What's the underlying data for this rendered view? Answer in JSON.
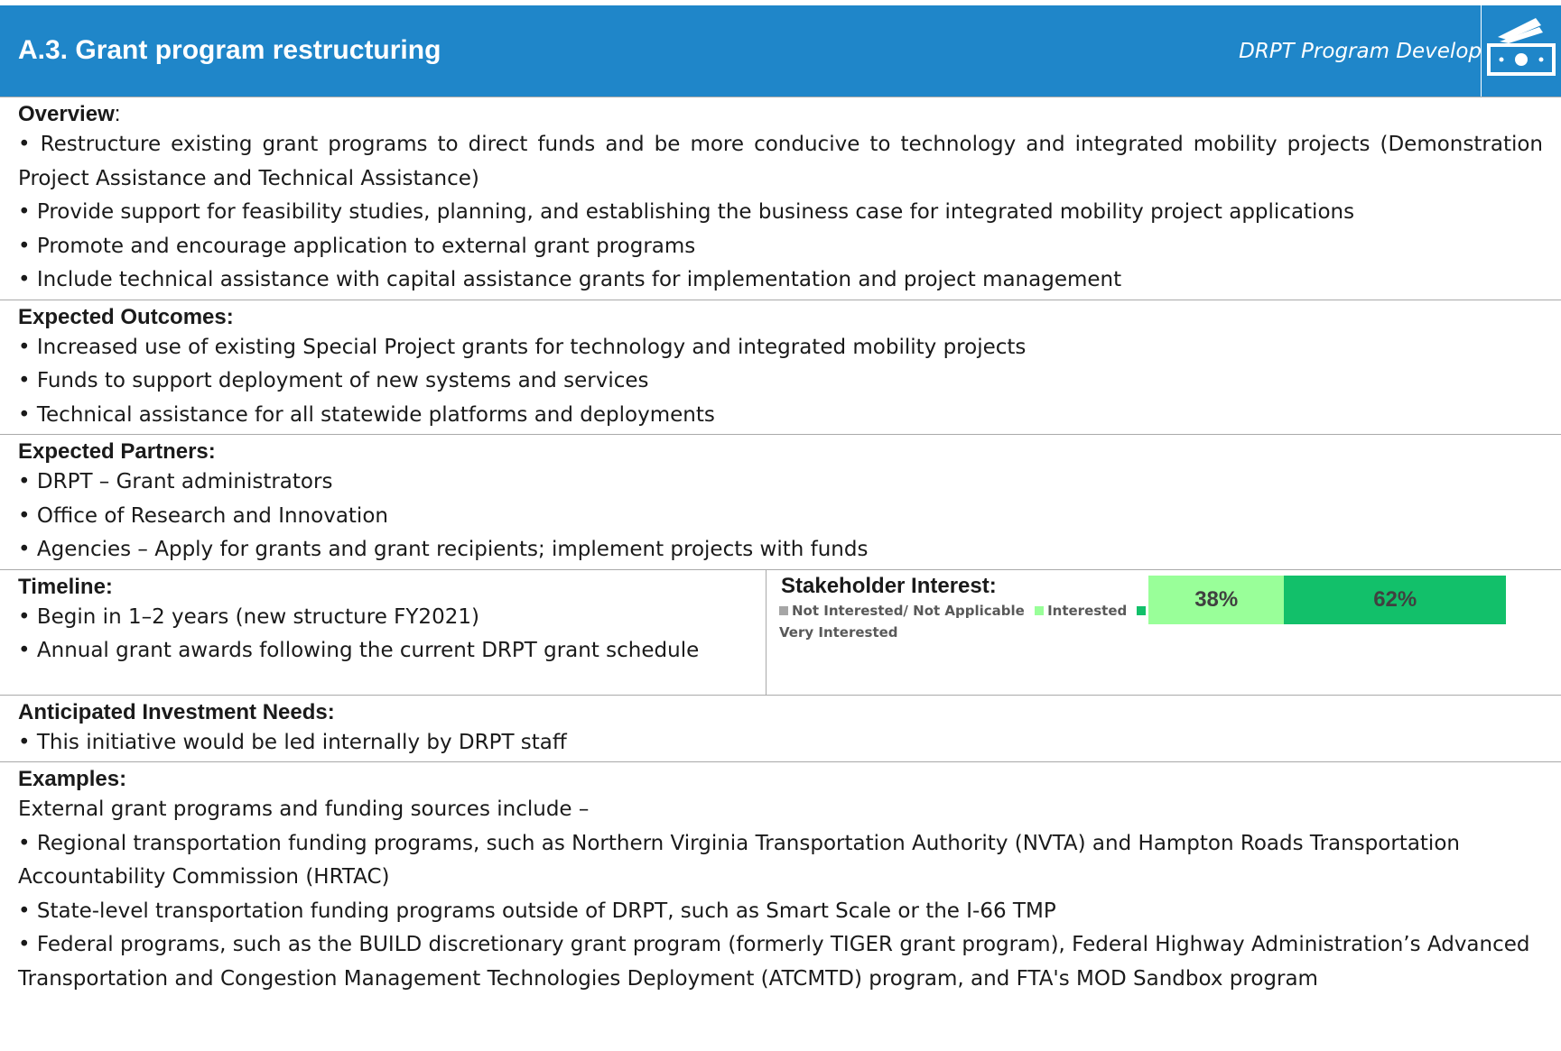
{
  "header": {
    "title": "A.3. Grant program restructuring",
    "subtitle": "DRPT Program Develop",
    "icon": "money-bill-icon",
    "color": "#1f86c9"
  },
  "overview": {
    "title": "Overview",
    "colon": ":",
    "items": [
      "• Restructure existing grant programs to direct funds and be more conducive to technology and integrated mobility projects (Demonstration Project Assistance and Technical Assistance)",
      "• Provide support for feasibility studies, planning, and establishing the business case for integrated mobility project applications",
      "• Promote and encourage application to external grant programs",
      "• Include technical assistance with capital assistance grants for implementation and project management"
    ]
  },
  "outcomes": {
    "title": "Expected Outcomes:",
    "items": [
      "• Increased use of existing Special Project grants for technology and integrated mobility projects",
      "• Funds to support deployment of new systems and services",
      "• Technical assistance for all statewide platforms and deployments"
    ]
  },
  "partners": {
    "title": "Expected Partners:",
    "items": [
      "• DRPT – Grant administrators",
      "• Office of Research and Innovation",
      "• Agencies – Apply for grants and grant recipients; implement projects with funds"
    ]
  },
  "timeline": {
    "title": "Timeline:",
    "items": [
      "• Begin in 1–2 years (new structure FY2021)",
      "• Annual grant awards following the current DRPT grant schedule"
    ]
  },
  "stakeholder": {
    "title": "Stakeholder Interest:",
    "legend": [
      {
        "label": "Not Interested/ Not Applicable",
        "color": "#a6a6a6"
      },
      {
        "label": "Interested",
        "color": "#99ff99"
      },
      {
        "label": "Very Interested",
        "color": "#12c06a"
      }
    ],
    "segments": [
      {
        "label": "38%",
        "value": 38,
        "color": "#99ff99"
      },
      {
        "label": "62%",
        "value": 62,
        "color": "#12c06a"
      }
    ]
  },
  "investment": {
    "title": "Anticipated Investment Needs:",
    "items": [
      "• This initiative would be led internally by DRPT staff"
    ]
  },
  "examples": {
    "title": "Examples:",
    "intro": "External grant programs and funding sources include –",
    "items": [
      "• Regional transportation funding programs, such as Northern Virginia Transportation Authority (NVTA) and Hampton Roads Transportation Accountability Commission (HRTAC)",
      "• State-level transportation funding programs outside of DRPT, such as Smart Scale or the I-66 TMP",
      "• Federal programs, such as the BUILD discretionary grant program (formerly TIGER grant program), Federal Highway Administration’s Advanced Transportation and Congestion Management Technologies Deployment (ATCMTD) program, and FTA's MOD Sandbox program"
    ]
  }
}
